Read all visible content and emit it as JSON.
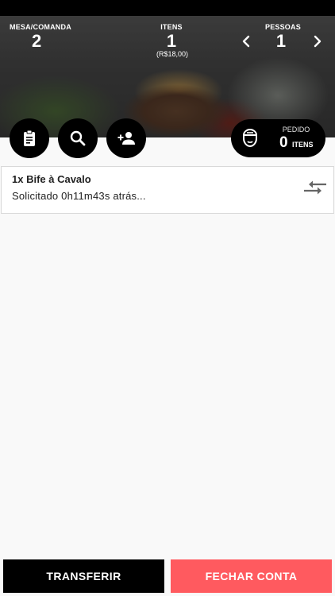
{
  "header": {
    "table": {
      "label": "MESA/COMANDA",
      "value": "2"
    },
    "items": {
      "label": "ITENS",
      "value": "1",
      "subtotal": "(R$18,00)"
    },
    "people": {
      "label": "PESSOAS",
      "value": "1"
    }
  },
  "actions": {
    "clipboard": "clipboard-icon",
    "search": "search-icon",
    "add_person": "add-person-icon"
  },
  "order": {
    "label": "PEDIDO",
    "count": "0",
    "unit": "ITENS",
    "icon": "chef-hat-icon"
  },
  "items_list": [
    {
      "title": "1x Bife à Cavalo",
      "status": "Solicitado 0h11m43s atrás..."
    }
  ],
  "footer": {
    "transfer_label": "TRANSFERIR",
    "close_label": "FECHAR CONTA"
  },
  "colors": {
    "primary": "#000000",
    "accent": "#ff5a5f",
    "background": "#f9f9f9"
  }
}
